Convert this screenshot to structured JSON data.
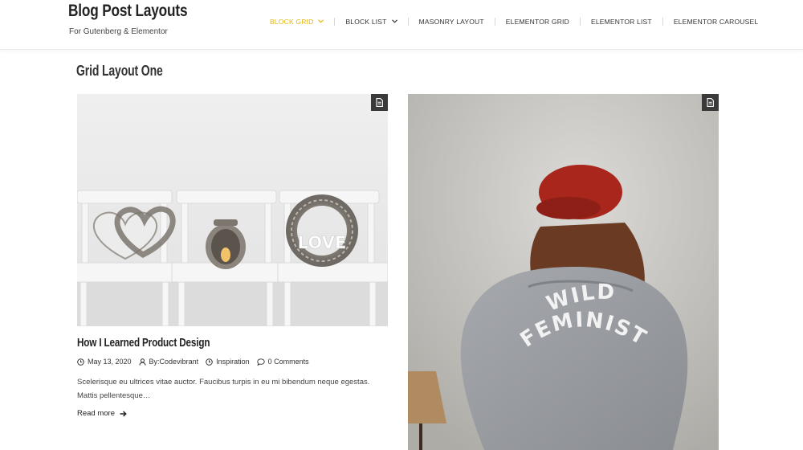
{
  "site": {
    "title": "Blog Post Layouts",
    "tagline": "For Gutenberg & Elementor"
  },
  "nav": {
    "items": [
      {
        "label": "Block Grid",
        "has_dropdown": true,
        "active": true
      },
      {
        "label": "Block List",
        "has_dropdown": true,
        "active": false
      },
      {
        "label": "Masonry Layout",
        "has_dropdown": false,
        "active": false
      },
      {
        "label": "Elementor Grid",
        "has_dropdown": false,
        "active": false
      },
      {
        "label": "Elementor List",
        "has_dropdown": false,
        "active": false
      },
      {
        "label": "Elementor Carousel",
        "has_dropdown": false,
        "active": false
      }
    ]
  },
  "page": {
    "title": "Grid Layout One"
  },
  "posts": [
    {
      "title": "How I Learned Product Design",
      "date": "May 13, 2020",
      "author": "By:Codevibrant",
      "category": "Inspiration",
      "comments": "0 Comments",
      "excerpt": "Scelerisque eu ultrices vitae auctor. Faucibus turpis in eu mi bibendum neque egestas. Mattis pellentesque…",
      "read_more": "Read more",
      "image_text": "LOVE"
    },
    {
      "image_text_line1": "WILD",
      "image_text_line2": "FEMINIST"
    }
  ],
  "icons": {
    "post_format": "document-icon",
    "date": "clock-icon",
    "author": "user-icon",
    "category": "clock-icon",
    "comments": "comment-icon",
    "read_more": "arrow-right-icon"
  },
  "colors": {
    "accent": "#e2b60c",
    "badge_bg": "#3a3a3a",
    "text": "#333333"
  }
}
